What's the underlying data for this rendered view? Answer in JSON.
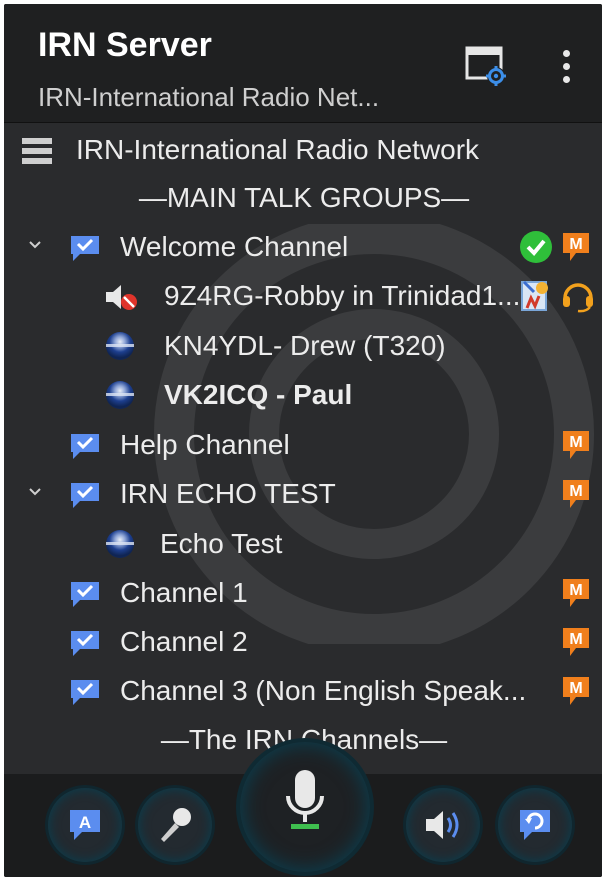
{
  "header": {
    "title": "IRN Server",
    "subtitle": "IRN-International Radio Net..."
  },
  "tree": {
    "server": "IRN-International Radio Network",
    "section_main": "—MAIN TALK GROUPS—",
    "welcome_channel": "Welcome Channel",
    "users_welcome": [
      "9Z4RG-Robby in Trinidad1...",
      "KN4YDL- Drew (T320)",
      "VK2ICQ - Paul"
    ],
    "help_channel": "Help Channel",
    "echo_channel": "IRN ECHO TEST",
    "echo_user": "Echo Test",
    "channel_1": "Channel 1",
    "channel_2": "Channel 2",
    "channel_3": "Channel 3 (Non English Speak...",
    "section_irn": "—The IRN Channels—"
  },
  "badges": {
    "m": "M",
    "a": "A"
  },
  "colors": {
    "accent_blue": "#5b8def",
    "badge_orange": "#f07f1c",
    "check_green": "#2fbf3a",
    "background": "#2a2b2d",
    "appbar": "#1f2021"
  }
}
